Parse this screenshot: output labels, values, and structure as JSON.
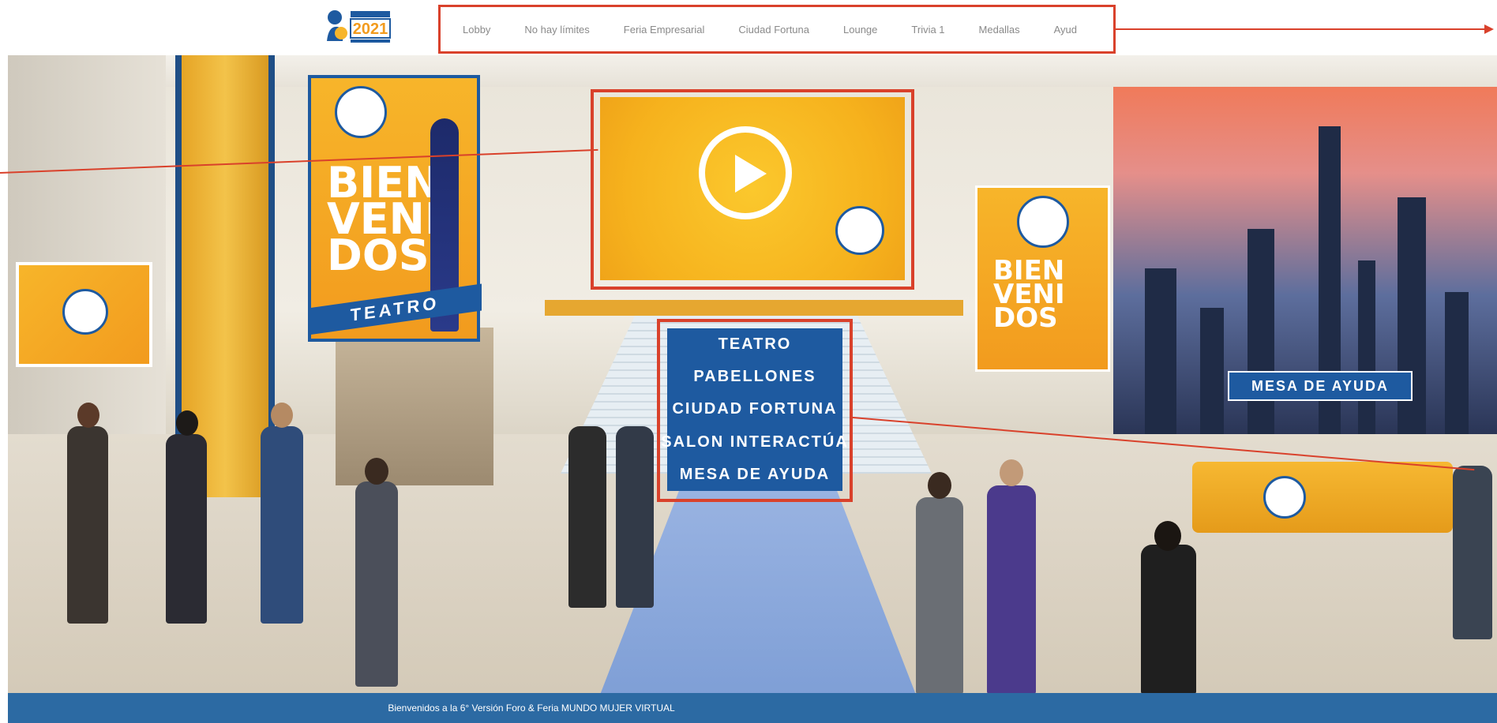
{
  "nav": {
    "items": [
      "Lobby",
      "No hay límites",
      "Feria Empresarial",
      "Ciudad Fortuna",
      "Lounge",
      "Trivia 1",
      "Medallas",
      "Ayud"
    ]
  },
  "logo": {
    "year": "2021"
  },
  "banner_left": {
    "text": "BIEN VENI DOS",
    "sign": "TEATRO"
  },
  "banner_right": {
    "text": "BIEN VENI DOS"
  },
  "video": {
    "icon": "play-icon"
  },
  "directory": {
    "items": [
      "TEATRO",
      "PABELLONES",
      "CIUDAD FORTUNA",
      "SALON INTERACTÚA",
      "MESA DE AYUDA"
    ]
  },
  "mesa_sign": "MESA DE AYUDA",
  "footer": {
    "text": "Bienvenidos a la 6° Versión Foro & Feria MUNDO MUJER VIRTUAL"
  },
  "colors": {
    "accent_red": "#d9412b",
    "brand_blue": "#1e5aa0",
    "brand_yellow": "#f7b52a"
  }
}
